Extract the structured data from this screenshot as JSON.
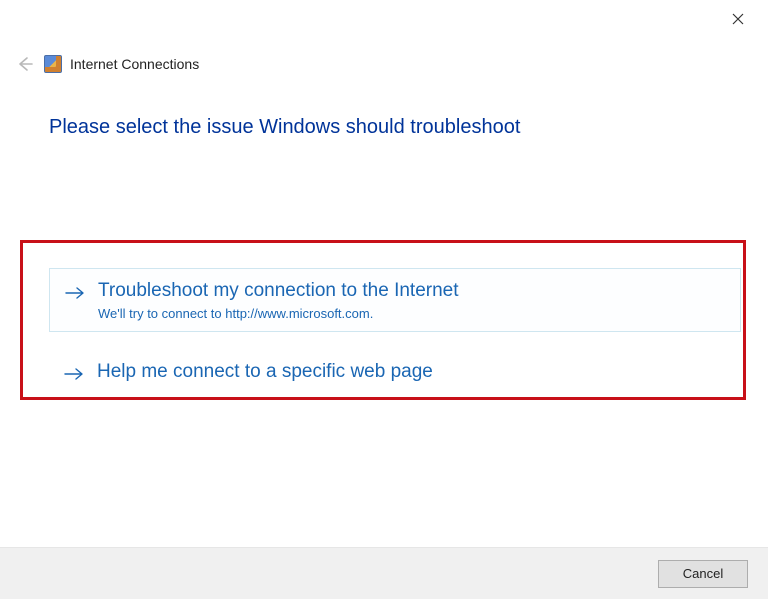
{
  "window": {
    "wizard_name": "Internet Connections"
  },
  "heading": "Please select the issue Windows should troubleshoot",
  "options": [
    {
      "title": "Troubleshoot my connection to the Internet",
      "description": "We'll try to connect to http://www.microsoft.com."
    },
    {
      "title": "Help me connect to a specific web page"
    }
  ],
  "footer": {
    "cancel_label": "Cancel"
  }
}
